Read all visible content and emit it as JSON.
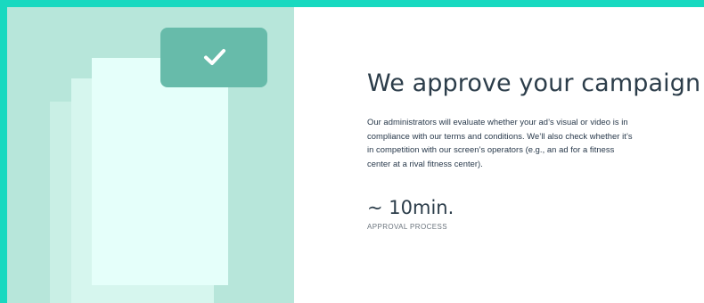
{
  "section": {
    "title": "We approve your campaign",
    "description": "Our administrators will evaluate whether your ad’s visual or video is in compliance with our terms and conditions. We’ll also check whether it’s in competition with our screen’s operators (e.g., an ad for a fitness center at a rival fitness center).",
    "metric": {
      "value": "~ 10min.",
      "label": "APPROVAL PROCESS"
    }
  },
  "illustration": {
    "badge_icon": "check-icon"
  },
  "colors": {
    "outer_border": "#18d9c0",
    "panel_background": "#b7e6da",
    "sheet_back": "#c9efe5",
    "sheet_middle": "#d6f6ee",
    "sheet_front": "#e5fffa",
    "badge": "#67bbaa",
    "text": "#2c3d4a",
    "muted_text": "#6b747d"
  }
}
